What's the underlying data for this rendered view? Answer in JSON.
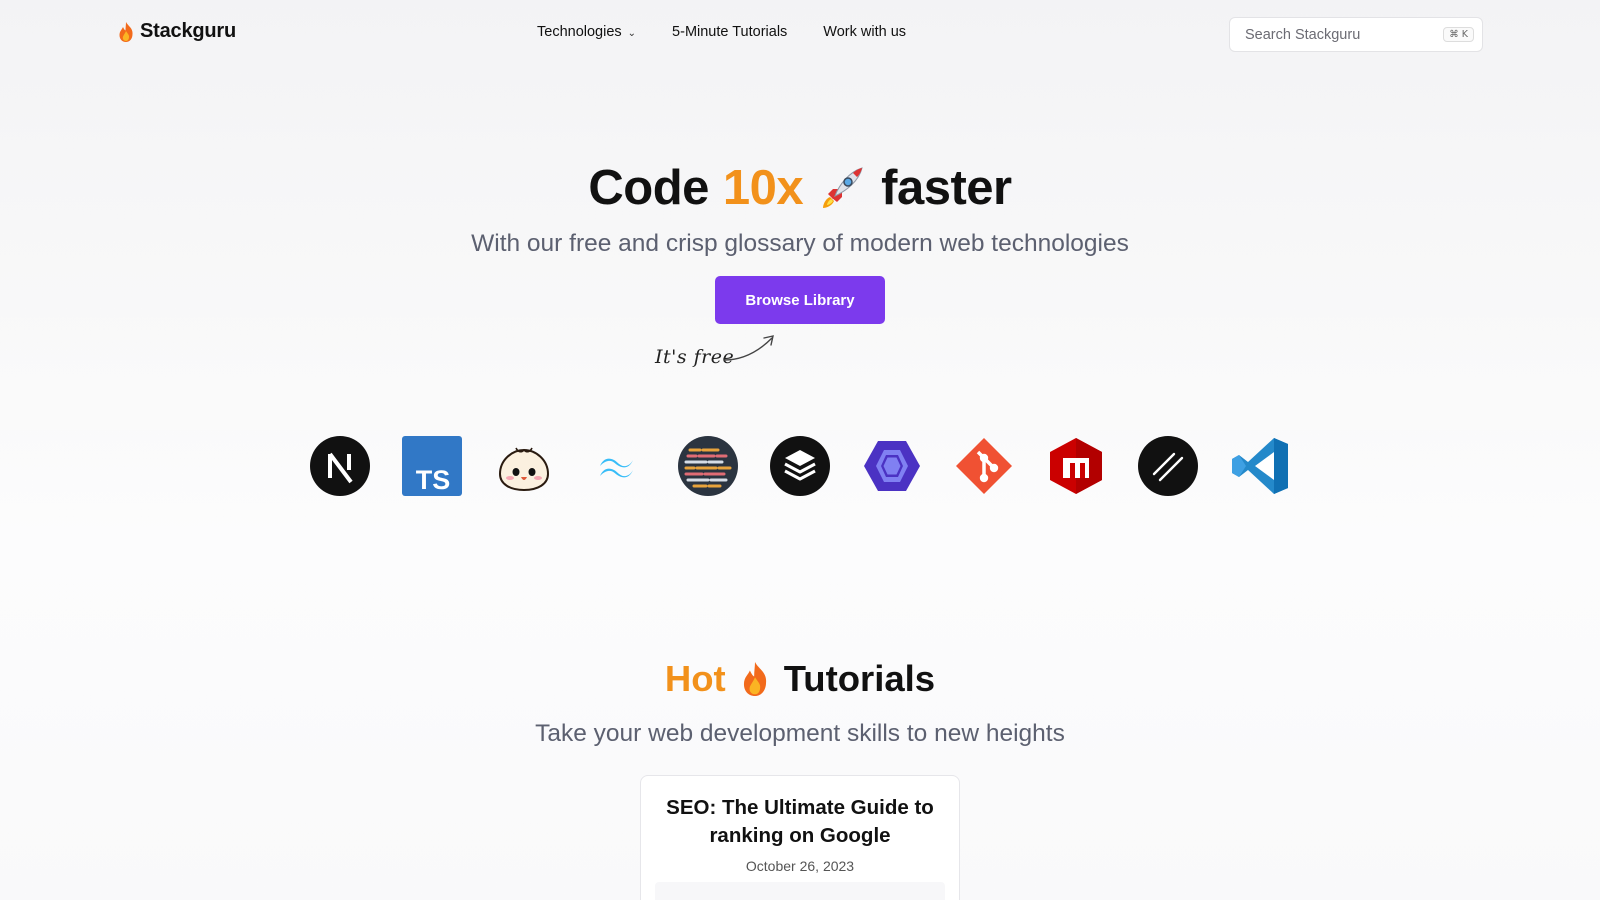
{
  "header": {
    "brand": "Stackguru",
    "nav": [
      {
        "label": "Technologies",
        "has_dropdown": true
      },
      {
        "label": "5-Minute Tutorials",
        "has_dropdown": false
      },
      {
        "label": "Work with us",
        "has_dropdown": false
      }
    ],
    "search": {
      "placeholder": "Search Stackguru",
      "shortcut": "⌘ K"
    }
  },
  "hero": {
    "title_prefix": "Code",
    "title_accent": "10x",
    "title_suffix": "faster",
    "subtitle": "With our free and crisp glossary of modern web technologies",
    "cta_label": "Browse Library",
    "note": "It's free"
  },
  "technologies": [
    {
      "name": "nextjs-icon"
    },
    {
      "name": "typescript-icon"
    },
    {
      "name": "bun-icon"
    },
    {
      "name": "tailwind-icon"
    },
    {
      "name": "code-editor-icon"
    },
    {
      "name": "stack-layers-icon"
    },
    {
      "name": "eslint-icon"
    },
    {
      "name": "git-icon"
    },
    {
      "name": "npm-icon"
    },
    {
      "name": "linear-icon"
    },
    {
      "name": "vscode-icon"
    }
  ],
  "tutorials": {
    "title_accent": "Hot",
    "title_suffix": "Tutorials",
    "subtitle": "Take your web development skills to new heights",
    "cards": [
      {
        "title": "SEO: The Ultimate Guide to ranking on Google",
        "date": "October 26, 2023"
      }
    ]
  },
  "colors": {
    "accent_orange": "#f2911b",
    "primary_purple": "#7c3aed",
    "muted_text": "#5c6070"
  }
}
